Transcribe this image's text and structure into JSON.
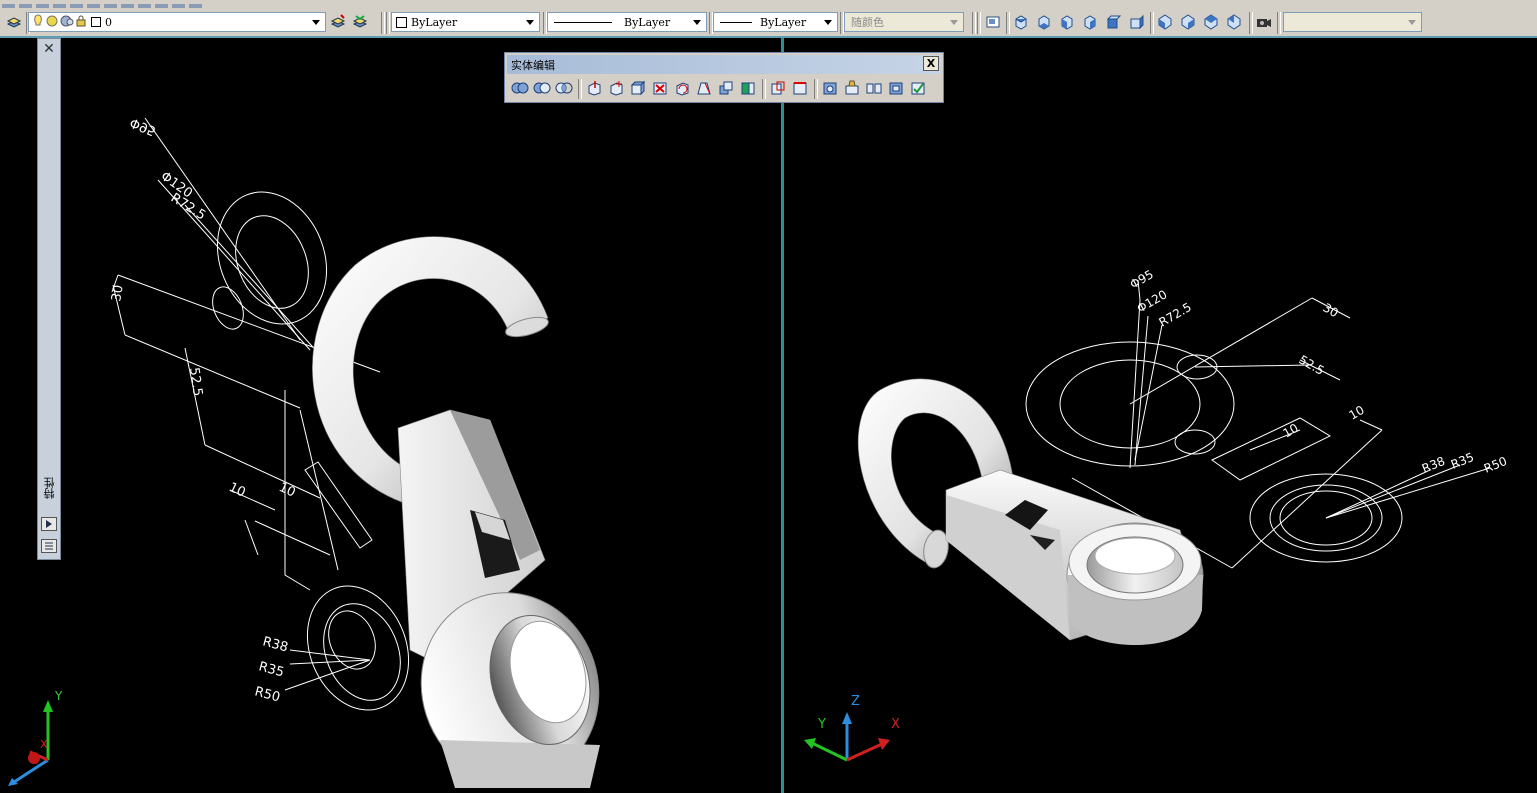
{
  "layers_toolbar": {
    "current_layer": "0"
  },
  "properties_toolbar": {
    "color_combo": "ByLayer",
    "linetype_combo": "ByLayer",
    "lineweight_combo": "ByLayer",
    "plotstyle_combo": "随颜色",
    "view_combo": ""
  },
  "properties_palette": {
    "title": "特性"
  },
  "solid_edit_toolbar": {
    "title": "实体编辑",
    "close_label": "X"
  },
  "left_viewport": {
    "dimensions": [
      "Φ95",
      "Φ120",
      "R72.5",
      "30",
      "52.5",
      "10",
      "10",
      "R38",
      "R35",
      "R50"
    ],
    "ucs": {
      "y_label": "Y",
      "x_label": "X"
    }
  },
  "right_viewport": {
    "dimensions": [
      "Φ95",
      "Φ120",
      "R72.5",
      "30",
      "52.5",
      "10",
      "10",
      "R38",
      "R35",
      "R50"
    ],
    "ucs": {
      "x_label": "X",
      "y_label": "Y",
      "z_label": "Z"
    }
  },
  "colors": {
    "ui_bg": "#d4d0c8",
    "viewport_bg": "#000000",
    "viewport_divider": "#2d8f95",
    "palette_bg": "#c8d0dc",
    "toolbar_title": "#b8c8e0"
  }
}
